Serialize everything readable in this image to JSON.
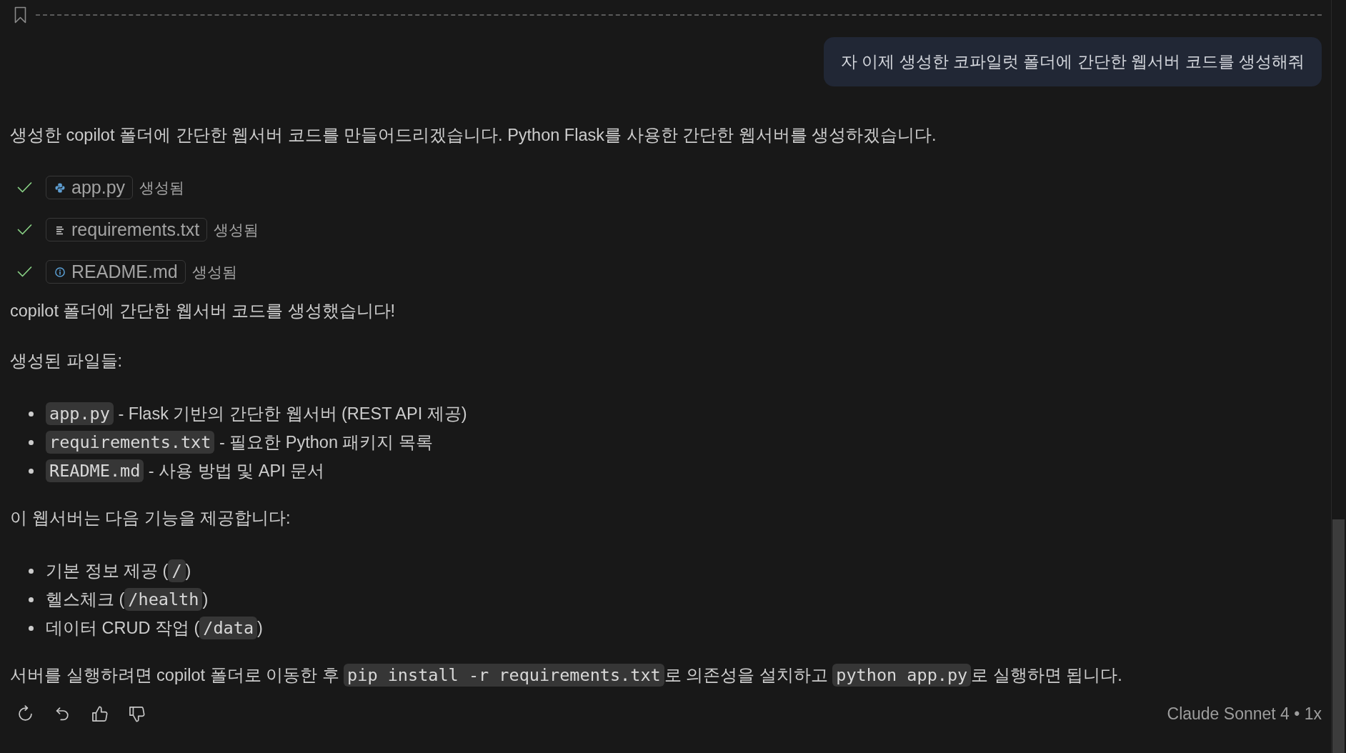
{
  "request": {
    "text": "자 이제 생성한 코파일럿 폴더에 간단한 웹서버 코드를 생성해줘"
  },
  "response": {
    "intro": "생성한 copilot 폴더에 간단한 웹서버 코드를 만들어드리겠습니다. Python Flask를 사용한 간단한 웹서버를 생성하겠습니다.",
    "file_edits": [
      {
        "kind": "python",
        "file": "app.py",
        "status": "생성됨",
        "done": true
      },
      {
        "kind": "text",
        "file": "requirements.txt",
        "status": "생성됨",
        "done": true
      },
      {
        "kind": "info",
        "file": "README.md",
        "status": "생성됨",
        "done": true
      }
    ],
    "blocks": [
      {
        "kind": "paragraph",
        "parts": [
          {
            "kind": "text",
            "text": "copilot 폴더에 간단한 웹서버 코드를 생성했습니다!"
          }
        ]
      },
      {
        "kind": "paragraph",
        "parts": [
          {
            "kind": "text",
            "text": "생성된 파일들:"
          }
        ]
      },
      {
        "kind": "list",
        "items": [
          {
            "parts": [
              {
                "kind": "code",
                "text": "app.py"
              },
              {
                "kind": "text",
                "text": " - Flask 기반의 간단한 웹서버 (REST API 제공)"
              }
            ]
          },
          {
            "parts": [
              {
                "kind": "code",
                "text": "requirements.txt"
              },
              {
                "kind": "text",
                "text": " - 필요한 Python 패키지 목록"
              }
            ]
          },
          {
            "parts": [
              {
                "kind": "code",
                "text": "README.md"
              },
              {
                "kind": "text",
                "text": " - 사용 방법 및 API 문서"
              }
            ]
          }
        ]
      },
      {
        "kind": "paragraph",
        "parts": [
          {
            "kind": "text",
            "text": "이 웹서버는 다음 기능을 제공합니다:"
          }
        ]
      },
      {
        "kind": "list",
        "items": [
          {
            "parts": [
              {
                "kind": "text",
                "text": "기본 정보 제공 ("
              },
              {
                "kind": "code",
                "text": "/"
              },
              {
                "kind": "text",
                "text": ")"
              }
            ]
          },
          {
            "parts": [
              {
                "kind": "text",
                "text": "헬스체크 ("
              },
              {
                "kind": "code",
                "text": "/health"
              },
              {
                "kind": "text",
                "text": ")"
              }
            ]
          },
          {
            "parts": [
              {
                "kind": "text",
                "text": "데이터 CRUD 작업 ("
              },
              {
                "kind": "code",
                "text": "/data"
              },
              {
                "kind": "text",
                "text": ")"
              }
            ]
          }
        ]
      },
      {
        "kind": "paragraph",
        "parts": [
          {
            "kind": "text",
            "text": "서버를 실행하려면 copilot 폴더로 이동한 후 "
          },
          {
            "kind": "code",
            "text": "pip install -r requirements.txt"
          },
          {
            "kind": "text",
            "text": "로 의존성을 설치하고 "
          },
          {
            "kind": "code",
            "text": "python app.py"
          },
          {
            "kind": "text",
            "text": "로 실행하면 됩니다."
          }
        ]
      }
    ]
  },
  "footer": {
    "model": "Claude Sonnet 4 • 1x"
  }
}
